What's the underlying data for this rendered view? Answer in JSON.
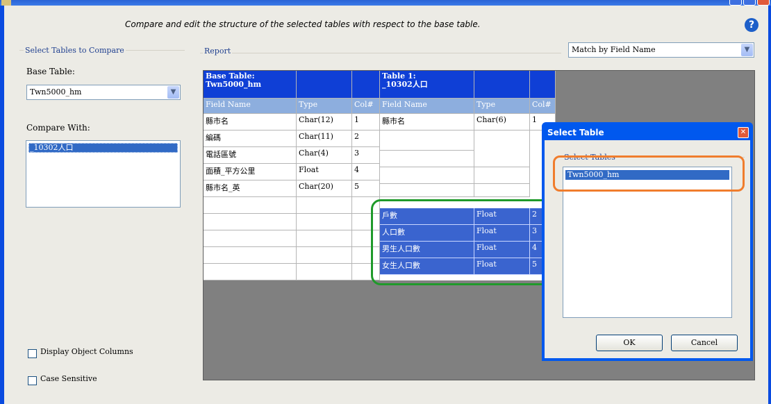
{
  "instruction": "Compare and edit the structure of the selected tables with respect to the base table.",
  "select_group": {
    "title": "Select Tables to Compare",
    "base_label": "Base Table:",
    "base_value": "Twn5000_hm",
    "compare_label": "Compare With:",
    "compare_items": [
      "_10302人口"
    ]
  },
  "report": {
    "title": "Report",
    "match_value": "Match by Field Name",
    "base_header": "Base Table:\nTwn5000_hm",
    "t1_header": "Table 1:\n_10302人口",
    "col_headers": {
      "field": "Field Name",
      "type": "Type",
      "col": "Col#"
    },
    "base_rows": [
      [
        "縣市名",
        "Char(12)",
        "1"
      ],
      [
        "編碼",
        "Char(11)",
        "2"
      ],
      [
        "電話區號",
        "Char(4)",
        "3"
      ],
      [
        "面積_平方公里",
        "Float",
        "4"
      ],
      [
        "縣市名_英",
        "Char(20)",
        "5"
      ]
    ],
    "t1_rows": [
      [
        "縣市名",
        "Char(6)",
        "1"
      ]
    ],
    "t1_extra_rows": [
      [
        "戶數",
        "Float",
        "2"
      ],
      [
        "人口數",
        "Float",
        "3"
      ],
      [
        "男生人口數",
        "Float",
        "4"
      ],
      [
        "女生人口數",
        "Float",
        "5"
      ]
    ]
  },
  "options": {
    "display_object_columns": "Display Object Columns",
    "case_sensitive": "Case Sensitive"
  },
  "dialog": {
    "title": "Select Table",
    "group_title": "Select Tables",
    "items": [
      "Twn5000_hm"
    ],
    "ok": "OK",
    "cancel": "Cancel"
  },
  "colors": {
    "header_dark": "#0f3fd6",
    "header_light": "#8daede",
    "selection": "#316ac5",
    "highlight_orange": "#f07d2d",
    "highlight_green": "#1f9a2a"
  }
}
